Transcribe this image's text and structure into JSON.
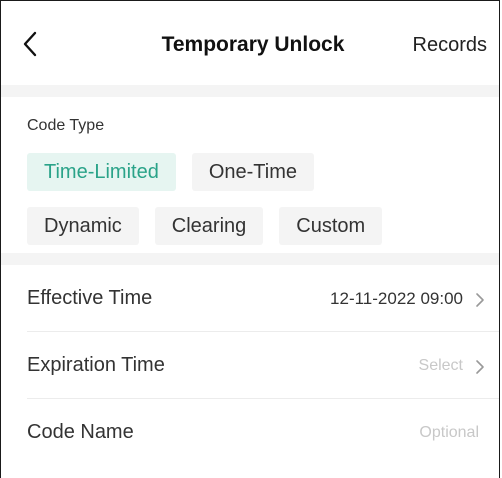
{
  "header": {
    "title": "Temporary Unlock",
    "records_label": "Records",
    "back_icon": "chevron-left-icon"
  },
  "code_type": {
    "label": "Code Type",
    "selected": "Time-Limited",
    "accent_color": "#2aa389",
    "rows": [
      [
        "Time-Limited",
        "One-Time"
      ],
      [
        "Dynamic",
        "Clearing",
        "Custom"
      ]
    ]
  },
  "fields": {
    "effective_time": {
      "label": "Effective Time",
      "value": "12-11-2022 09:00"
    },
    "expiration_time": {
      "label": "Expiration Time",
      "placeholder": "Select"
    },
    "code_name": {
      "label": "Code Name",
      "placeholder": "Optional"
    }
  }
}
